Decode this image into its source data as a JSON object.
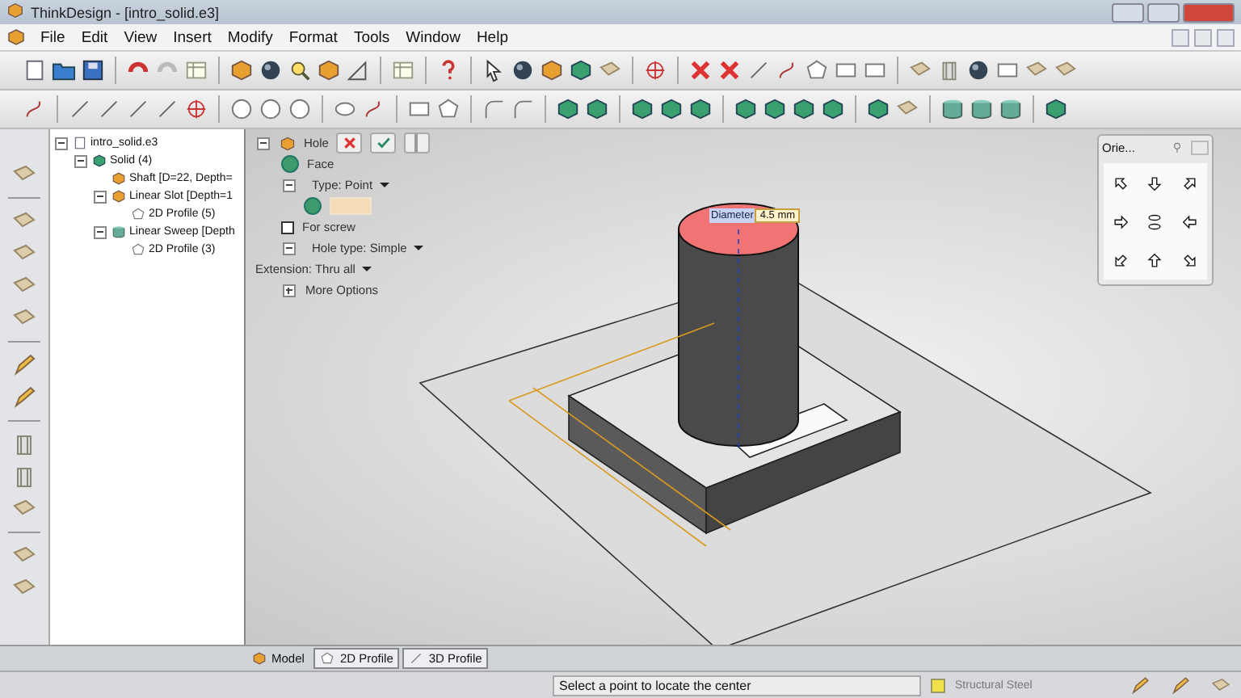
{
  "window": {
    "title": "ThinkDesign - [intro_solid.e3]"
  },
  "menu": [
    "File",
    "Edit",
    "View",
    "Insert",
    "Modify",
    "Format",
    "Tools",
    "Window",
    "Help"
  ],
  "tree": [
    {
      "label": "intro_solid.e3",
      "kind": "file",
      "expanded": true,
      "children": [
        {
          "label": "Solid (4)",
          "kind": "solid",
          "expanded": true,
          "children": [
            {
              "label": "Shaft [D=22, Depth=",
              "kind": "feature"
            },
            {
              "label": "Linear Slot [Depth=1",
              "kind": "feature",
              "expanded": true,
              "children": [
                {
                  "label": "2D Profile (5)",
                  "kind": "profile"
                }
              ]
            },
            {
              "label": "Linear Sweep [Depth",
              "kind": "sweep",
              "expanded": true,
              "children": [
                {
                  "label": "2D Profile (3)",
                  "kind": "profile"
                }
              ]
            }
          ]
        }
      ]
    }
  ],
  "hole_panel": {
    "title": "Hole",
    "rows": [
      {
        "kind": "done",
        "label": "Face"
      },
      {
        "kind": "dropdown",
        "label": "Type: Point",
        "expanded": true
      },
      {
        "kind": "pick"
      },
      {
        "kind": "checkbox",
        "label": "For screw",
        "checked": false
      },
      {
        "kind": "dropdown",
        "label": "Hole type: Simple",
        "expanded": true
      },
      {
        "kind": "plain-dropdown",
        "label": "Extension: Thru all"
      },
      {
        "kind": "section",
        "label": "More Options",
        "expanded": false
      }
    ]
  },
  "dimension_tag": {
    "label": "Diameter",
    "value": "4.5 mm"
  },
  "orientation_palette": {
    "title": "Orie..."
  },
  "view_tabs": [
    {
      "label": "Model",
      "kind": "model",
      "selected": true
    },
    {
      "label": "2D Profile",
      "kind": "profile2d",
      "selected": false
    },
    {
      "label": "3D Profile",
      "kind": "profile3d",
      "selected": false
    }
  ],
  "status_bar": {
    "message": "Select a point to locate the center",
    "material": "Structural Steel"
  }
}
